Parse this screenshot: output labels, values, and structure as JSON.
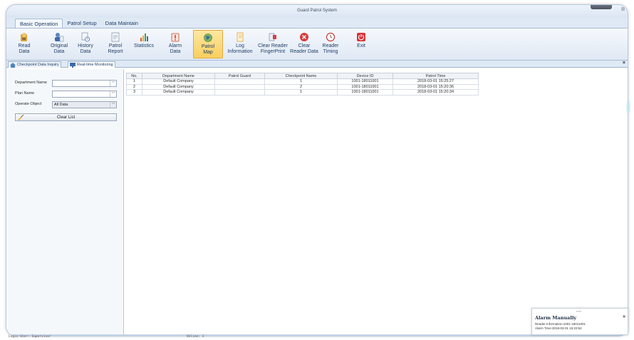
{
  "window": {
    "title": "Guard Patrol System"
  },
  "menu_tabs": [
    "Basic Operation",
    "Patrol Setup",
    "Data Maintain"
  ],
  "ribbon": [
    {
      "label": "Read\nData",
      "icon": "read-data-icon"
    },
    {
      "label": "Original\nData",
      "icon": "original-data-icon"
    },
    {
      "label": "History\nData",
      "icon": "history-data-icon"
    },
    {
      "label": "Patrol\nReport",
      "icon": "patrol-report-icon"
    },
    {
      "label": "Statistics",
      "icon": "statistics-icon"
    },
    {
      "label": "Alarm\nData",
      "icon": "alarm-data-icon"
    },
    {
      "label": "Patrol\nMap",
      "icon": "patrol-map-icon"
    },
    {
      "label": "Log\nInformation",
      "icon": "log-information-icon"
    },
    {
      "label": "Clear Reader\nFingerPrint",
      "icon": "clear-fingerprint-icon"
    },
    {
      "label": "Clear\nReader Data",
      "icon": "clear-reader-data-icon"
    },
    {
      "label": "Reader\nTiming",
      "icon": "reader-timing-icon"
    },
    {
      "label": "Exit",
      "icon": "exit-icon"
    }
  ],
  "ribbon_active": "Patrol Map",
  "pane_tabs": [
    "Checkpoint Data Inquiry",
    "Real-time Monitoring"
  ],
  "filters": {
    "department_label": "Department Name",
    "department_value": "",
    "plan_label": "Plan Name",
    "plan_value": "",
    "operate_label": "Operate Object",
    "operate_value": "All Data",
    "clear_button": "Clear List"
  },
  "table": {
    "headers": [
      "No.",
      "Department Name",
      "Patrol Guard",
      "Checkpoint Name",
      "Device ID",
      "Patrol Time"
    ],
    "rows": [
      [
        "1",
        "Default Company",
        "",
        "1",
        "1001-18011001",
        "2018-03-01 15:25:27"
      ],
      [
        "2",
        "Default Company",
        "",
        "2",
        "1001-18011001",
        "2018-03-01 15:20:36"
      ],
      [
        "3",
        "Default Company",
        "",
        "1",
        "1001-18011001",
        "2018-03-01 15:20:34"
      ]
    ]
  },
  "status": {
    "user": "Login User: Supervisor",
    "online": "Online: 1"
  },
  "alarm_popup": {
    "title": "Alarm Manually",
    "reader_info": "Reader Information:1001-18011001",
    "alarm_time": "Alarm Time:2018-03-01 15:23:52"
  },
  "colors": {
    "accent": "#f8cf5d",
    "ribbon_bg": "#dfe8f4",
    "window_bg": "#dfe9f5"
  }
}
